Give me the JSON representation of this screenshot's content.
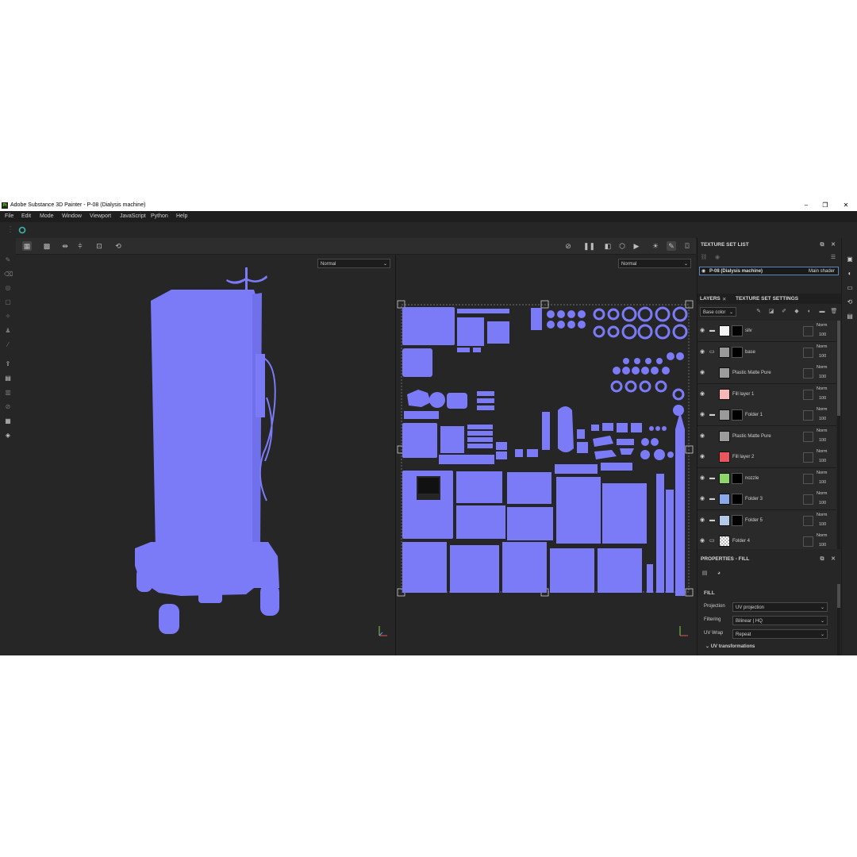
{
  "window": {
    "title": "Adobe Substance 3D Painter - P-08 (Dialysis machine)",
    "logo_text": "Pt"
  },
  "menu": [
    "File",
    "Edit",
    "Mode",
    "Window",
    "Viewport",
    "JavaScript",
    "Python",
    "Help"
  ],
  "viewport_3d": {
    "blend_mode": "Normal"
  },
  "viewport_2d": {
    "blend_mode": "Normal"
  },
  "texture_set_list": {
    "title": "TEXTURE SET LIST",
    "item_name": "P-08 (Dialysis machine)",
    "item_shader": "Main shader"
  },
  "tabs": {
    "layers": "LAYERS",
    "texture_set_settings": "TEXTURE SET SETTINGS"
  },
  "channel_dropdown": "Base color",
  "layers": [
    {
      "name": "silv",
      "type": "folder",
      "color": "#f2f2f2",
      "mask": true,
      "blend": "Norm",
      "opacity": "100"
    },
    {
      "name": "base",
      "type": "folder-open",
      "color": "#9a9a9a",
      "mask": true,
      "blend": "Norm",
      "opacity": "100"
    },
    {
      "name": "Plastic Matte Pure",
      "type": "fill",
      "color": "#9c9c9c",
      "mask": false,
      "blend": "Norm",
      "opacity": "100"
    },
    {
      "name": "Fill layer 1",
      "type": "fill",
      "color": "#f7b8b8",
      "mask": false,
      "blend": "Norm",
      "opacity": "100"
    },
    {
      "name": "Folder 1",
      "type": "folder",
      "color": "#9a9a9a",
      "mask": true,
      "blend": "Norm",
      "opacity": "100"
    },
    {
      "name": "Plastic Matte Pure",
      "type": "fill",
      "color": "#9c9c9c",
      "mask": false,
      "blend": "Norm",
      "opacity": "100"
    },
    {
      "name": "Fill layer 2",
      "type": "fill",
      "color": "#e8575d",
      "mask": false,
      "blend": "Norm",
      "opacity": "100"
    },
    {
      "name": "nozzle",
      "type": "folder",
      "color": "#8ed66a",
      "mask": true,
      "blend": "Norm",
      "opacity": "100"
    },
    {
      "name": "Folder 3",
      "type": "folder",
      "color": "#8aa9e8",
      "mask": true,
      "blend": "Norm",
      "opacity": "100"
    },
    {
      "name": "Folder 5",
      "type": "folder",
      "color": "#b4c9e8",
      "mask": true,
      "blend": "Norm",
      "opacity": "100"
    },
    {
      "name": "Folder 4",
      "type": "folder-open",
      "color": "checker",
      "mask": false,
      "blend": "Norm",
      "opacity": "100"
    }
  ],
  "properties": {
    "title": "PROPERTIES - FILL",
    "section": "FILL",
    "projection_label": "Projection",
    "projection_value": "UV projection",
    "filtering_label": "Filtering",
    "filtering_value": "Bilinear | HQ",
    "uvwrap_label": "UV Wrap",
    "uvwrap_value": "Repeat",
    "uv_transformations": "UV transformations"
  },
  "colors": {
    "mesh": "#7b7bf8",
    "background": "#262626",
    "accent": "#5a87c0"
  }
}
